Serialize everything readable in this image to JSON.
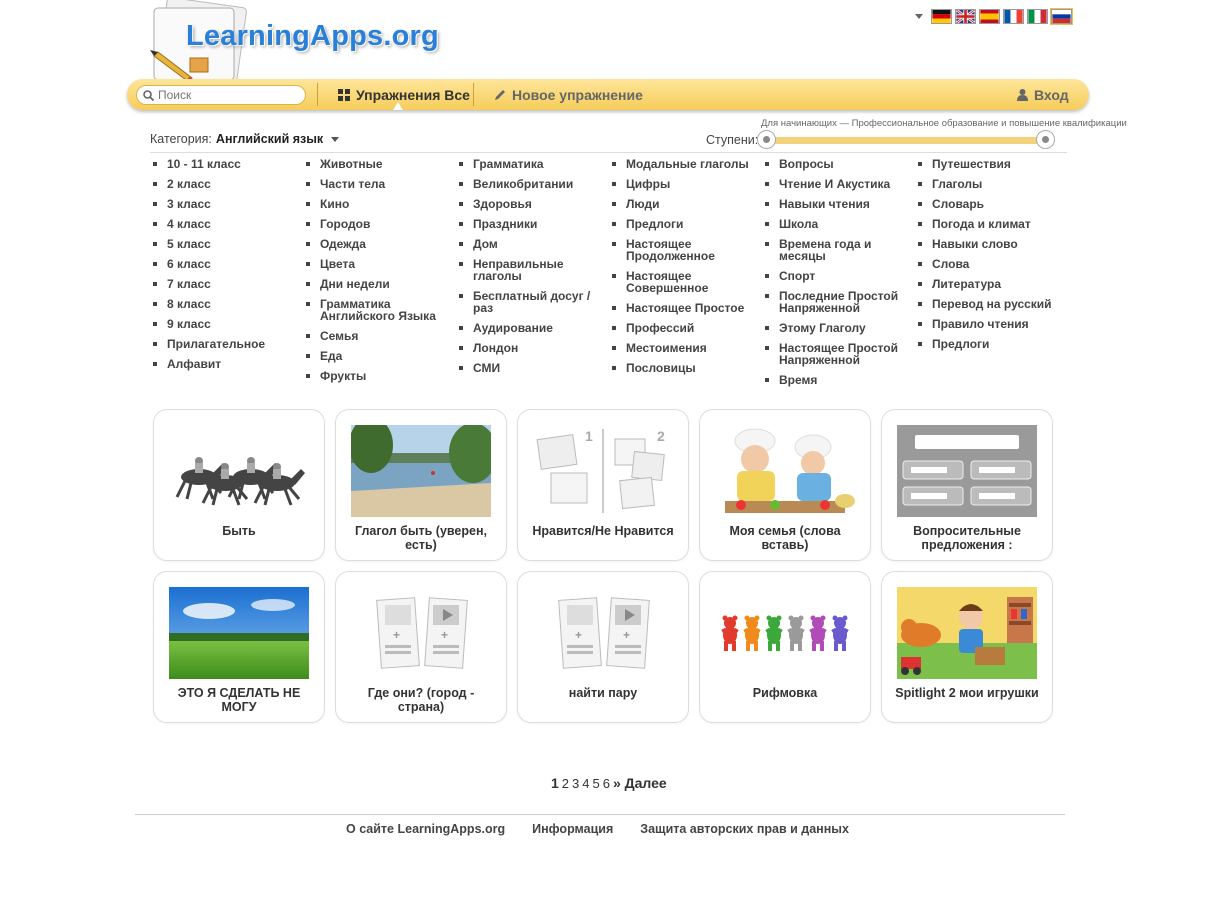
{
  "header": {
    "logo_text": "LearningApps.org",
    "languages": [
      {
        "code": "de",
        "active": false
      },
      {
        "code": "en",
        "active": false
      },
      {
        "code": "es",
        "active": false
      },
      {
        "code": "fr",
        "active": false
      },
      {
        "code": "it",
        "active": false
      },
      {
        "code": "ru",
        "active": true
      }
    ]
  },
  "nav": {
    "search_placeholder": "Поиск",
    "exercises_label": "Упражнения Все",
    "new_exercise_label": "Новое упражнение",
    "login_label": "Вход"
  },
  "filters": {
    "category_label": "Категория:",
    "category_value": "Английский язык",
    "level_caption": "Для начинающих — Профессиональное образование и повышение квалификации",
    "level_label": "Ступени:"
  },
  "topics": [
    [
      "10 - 11 класс",
      "2 класс",
      "3 класс",
      "4 класс",
      "5 класс",
      "6 класс",
      "7 класс",
      "8 класс",
      "9 класс",
      "Прилагательное",
      "Алфавит"
    ],
    [
      "Животные",
      "Части тела",
      "Кино",
      "Городов",
      "Одежда",
      "Цвета",
      "Дни недели",
      "Грамматика Английского Языка",
      "Семья",
      "Еда",
      "Фрукты"
    ],
    [
      "Грамматика",
      "Великобритании",
      "Здоровья",
      "Праздники",
      "Дом",
      "Неправильные глаголы",
      "Бесплатный досуг / раз",
      "Аудирование",
      "Лондон",
      "СМИ"
    ],
    [
      "Модальные глаголы",
      "Цифры",
      "Люди",
      "Предлоги",
      "Настоящее Продолженное",
      "Настоящее Совершенное",
      "Настоящее Простое",
      "Профессий",
      "Местоимения",
      "Пословицы"
    ],
    [
      "Вопросы",
      "Чтение И Акустика",
      "Навыки чтения",
      "Школа",
      "Времена года и месяцы",
      "Спорт",
      "Последние Простой Напряженной",
      "Этому Глаголу",
      "Настоящее Простой Напряженной",
      "Время"
    ],
    [
      "Путешествия",
      "Глаголы",
      "Словарь",
      "Погода и климат",
      "Навыки слово",
      "Слова",
      "Литература",
      "Перевод на русский",
      "Правило чтения",
      "Предлоги"
    ]
  ],
  "cards": [
    {
      "title": "Быть",
      "thumb": "horse-race"
    },
    {
      "title": "Глагол быть (уверен, есть)",
      "thumb": "lake-beach"
    },
    {
      "title": "Нравится/Не Нравится",
      "thumb": "group-assignment"
    },
    {
      "title": "Моя семья (слова вставь)",
      "thumb": "kids-cooking"
    },
    {
      "title": "Вопросительные предложения :",
      "thumb": "blank-fields"
    },
    {
      "title": "ЭТО Я СДЕЛАТЬ НЕ МОГУ",
      "thumb": "green-field"
    },
    {
      "title": "Где они? (город - страна)",
      "thumb": "matching-pairs"
    },
    {
      "title": "найти пару",
      "thumb": "matching-pairs"
    },
    {
      "title": "Рифмовка",
      "thumb": "dancing-bears"
    },
    {
      "title": "Spitlight 2 мои игрушки",
      "thumb": "toys-room"
    }
  ],
  "pagination": {
    "current": "1",
    "pages": [
      "2",
      "3",
      "4",
      "5",
      "6"
    ],
    "next_label": "» Далее"
  },
  "footer": {
    "links": [
      "О сайте LearningApps.org",
      "Информация",
      "Защита авторских прав и данных"
    ]
  }
}
